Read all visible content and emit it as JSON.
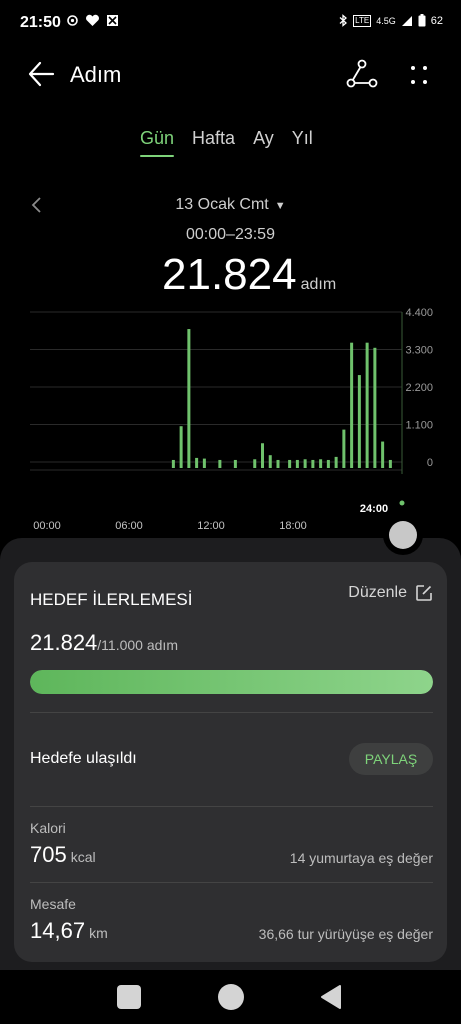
{
  "status": {
    "time": "21:50",
    "network": "4.5G",
    "lte": "LTE",
    "battery": "62"
  },
  "header": {
    "title": "Adım",
    "back_icon": "arrow-left-icon",
    "share_icon": "share-nodes-icon",
    "more_icon": "more-dots-icon"
  },
  "tabs": [
    {
      "label": "Gün",
      "active": true
    },
    {
      "label": "Hafta",
      "active": false
    },
    {
      "label": "Ay",
      "active": false
    },
    {
      "label": "Yıl",
      "active": false
    }
  ],
  "date": {
    "label": "13 Ocak Cmt",
    "caret": "▼",
    "range": "00:00–23:59"
  },
  "total": {
    "value": "21.824",
    "unit": "adım"
  },
  "chart_data": {
    "type": "bar",
    "y_ticks": [
      "4.400",
      "3.300",
      "2.200",
      "1.100",
      "0"
    ],
    "ylim": [
      0,
      4400
    ],
    "x_ticks": [
      "00:00",
      "06:00",
      "12:00",
      "18:00"
    ],
    "current_marker": "24:00",
    "bar_color": "#6fc26c",
    "bars": [
      {
        "hour": 9.25,
        "value": 60
      },
      {
        "hour": 9.75,
        "value": 1050
      },
      {
        "hour": 10.25,
        "value": 3900
      },
      {
        "hour": 10.75,
        "value": 120
      },
      {
        "hour": 11.25,
        "value": 100
      },
      {
        "hour": 12.25,
        "value": 60
      },
      {
        "hour": 13.25,
        "value": 60
      },
      {
        "hour": 14.5,
        "value": 80
      },
      {
        "hour": 15.0,
        "value": 550
      },
      {
        "hour": 15.5,
        "value": 200
      },
      {
        "hour": 16.0,
        "value": 60
      },
      {
        "hour": 16.75,
        "value": 60
      },
      {
        "hour": 17.25,
        "value": 60
      },
      {
        "hour": 17.75,
        "value": 80
      },
      {
        "hour": 18.25,
        "value": 60
      },
      {
        "hour": 18.75,
        "value": 80
      },
      {
        "hour": 19.25,
        "value": 60
      },
      {
        "hour": 19.75,
        "value": 150
      },
      {
        "hour": 20.25,
        "value": 950
      },
      {
        "hour": 20.75,
        "value": 3500
      },
      {
        "hour": 21.25,
        "value": 2550
      },
      {
        "hour": 21.75,
        "value": 3500
      },
      {
        "hour": 22.25,
        "value": 3350
      },
      {
        "hour": 22.75,
        "value": 600
      },
      {
        "hour": 23.25,
        "value": 60
      }
    ]
  },
  "goal": {
    "title": "HEDEF İLERLEMESİ",
    "edit_label": "Düzenle",
    "current": "21.824",
    "target": "/11.000 adım",
    "progress": 1.0,
    "reached_label": "Hedefe ulaşıldı",
    "share_label": "PAYLAŞ"
  },
  "calories": {
    "label": "Kalori",
    "value": "705",
    "unit": "kcal",
    "equivalent": "14 yumurtaya eş değer"
  },
  "distance": {
    "label": "Mesafe",
    "value": "14,67",
    "unit": "km",
    "equivalent": "36,66 tur yürüyüşe eş değer"
  }
}
